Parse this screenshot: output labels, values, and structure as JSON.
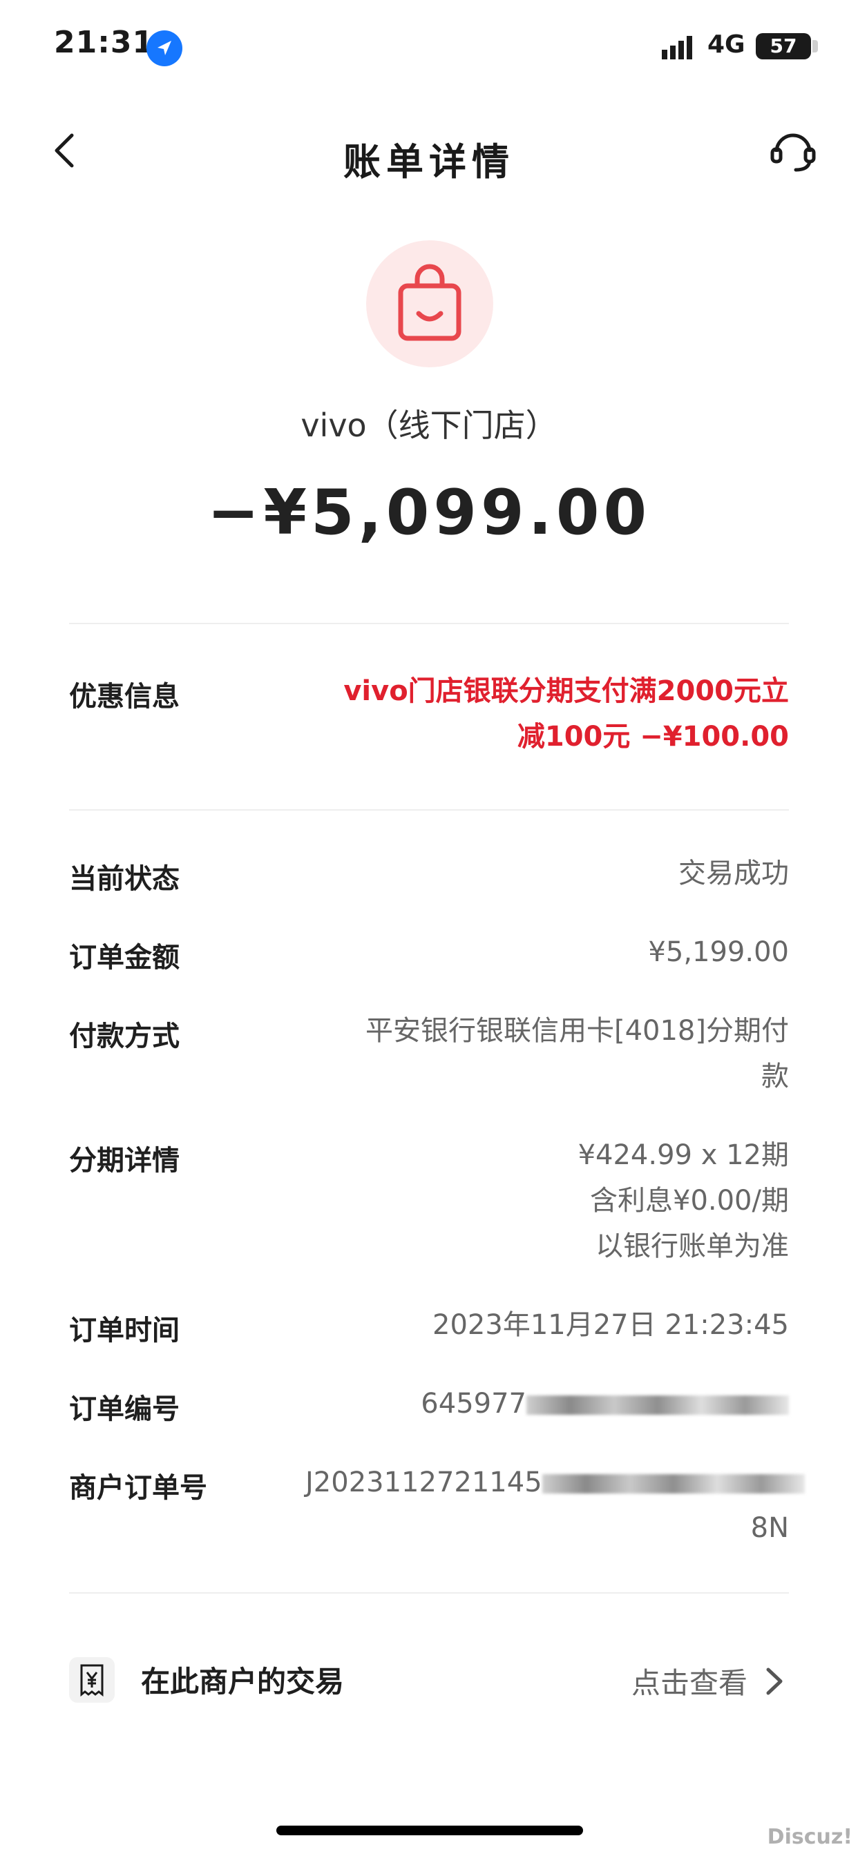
{
  "status_bar": {
    "time": "21:31",
    "network": "4G",
    "battery": "57"
  },
  "nav": {
    "title": "账单详情"
  },
  "merchant": {
    "name": "vivo（线下门店）",
    "amount": "−¥5,099.00"
  },
  "discount": {
    "label": "优惠信息",
    "line1": "vivo门店银联分期支付满2000元立",
    "line2": "减100元 −¥100.00"
  },
  "details": {
    "status_label": "当前状态",
    "status_value": "交易成功",
    "order_amount_label": "订单金额",
    "order_amount_value": "¥5,199.00",
    "payment_label": "付款方式",
    "payment_line1": "平安银行银联信用卡[4018]分期付",
    "payment_line2": "款",
    "installment_label": "分期详情",
    "installment_line1": "¥424.99 x 12期",
    "installment_line2": "含利息¥0.00/期",
    "installment_line3": "以银行账单为准",
    "order_time_label": "订单时间",
    "order_time_value": "2023年11月27日 21:23:45",
    "order_no_label": "订单编号",
    "order_no_value": "645977",
    "merchant_order_label": "商户订单号",
    "merchant_order_value": "J2023112721145",
    "merchant_order_tail": "8N"
  },
  "merchant_tx": {
    "label": "在此商户的交易",
    "link": "点击查看"
  },
  "watermark": "Discuz!",
  "colors": {
    "discount_red": "#e0202e",
    "icon_red": "#e8474d",
    "icon_bg": "#fde9e9"
  }
}
